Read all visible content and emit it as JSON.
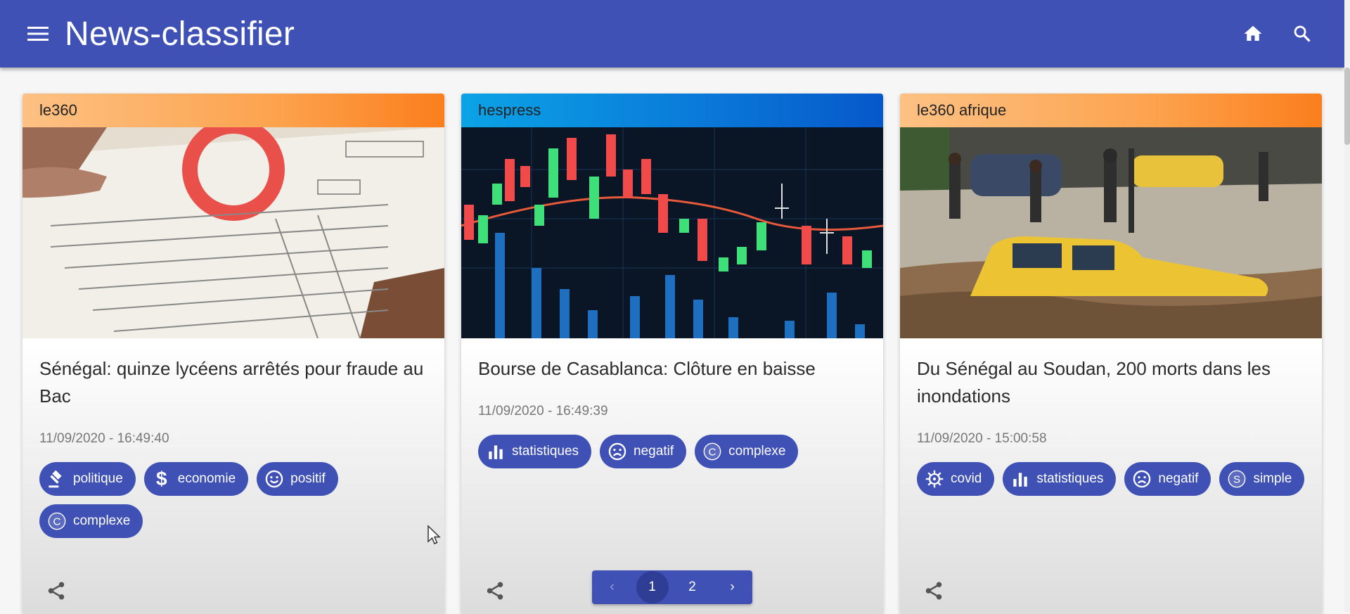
{
  "app": {
    "title": "News-classifier"
  },
  "colors": {
    "primary": "#3f51b5",
    "orange_header": "#fc8a2a",
    "blue_header": "#0a77d8"
  },
  "header": {
    "icons": [
      "menu-icon",
      "home-icon",
      "search-icon"
    ]
  },
  "cards": [
    {
      "source": "le360",
      "title": "Sénégal: quinze lycéens arrêtés pour fraude au Bac",
      "date": "11/09/2020 - 16:49:40",
      "tags": [
        "politique",
        "economie",
        "positif",
        "complexe"
      ],
      "tag_icons": [
        "gavel-icon",
        "dollar-icon",
        "smile-icon",
        "c-circle-icon"
      ]
    },
    {
      "source": "hespress",
      "title": "Bourse de Casablanca: Clôture en baisse",
      "date": "11/09/2020 - 16:49:39",
      "tags": [
        "statistiques",
        "negatif",
        "complexe"
      ],
      "tag_icons": [
        "bar-chart-icon",
        "sad-icon",
        "c-circle-icon"
      ]
    },
    {
      "source": "le360 afrique",
      "title": "Du Sénégal au Soudan, 200 morts dans les inondations",
      "date": "11/09/2020 - 15:00:58",
      "tags": [
        "covid",
        "statistiques",
        "negatif",
        "simple"
      ],
      "tag_icons": [
        "virus-icon",
        "bar-chart-icon",
        "sad-icon",
        "s-circle-icon"
      ]
    }
  ],
  "pagination": {
    "prev": "‹",
    "pages": [
      "1",
      "2"
    ],
    "current": "1",
    "next": "›"
  }
}
